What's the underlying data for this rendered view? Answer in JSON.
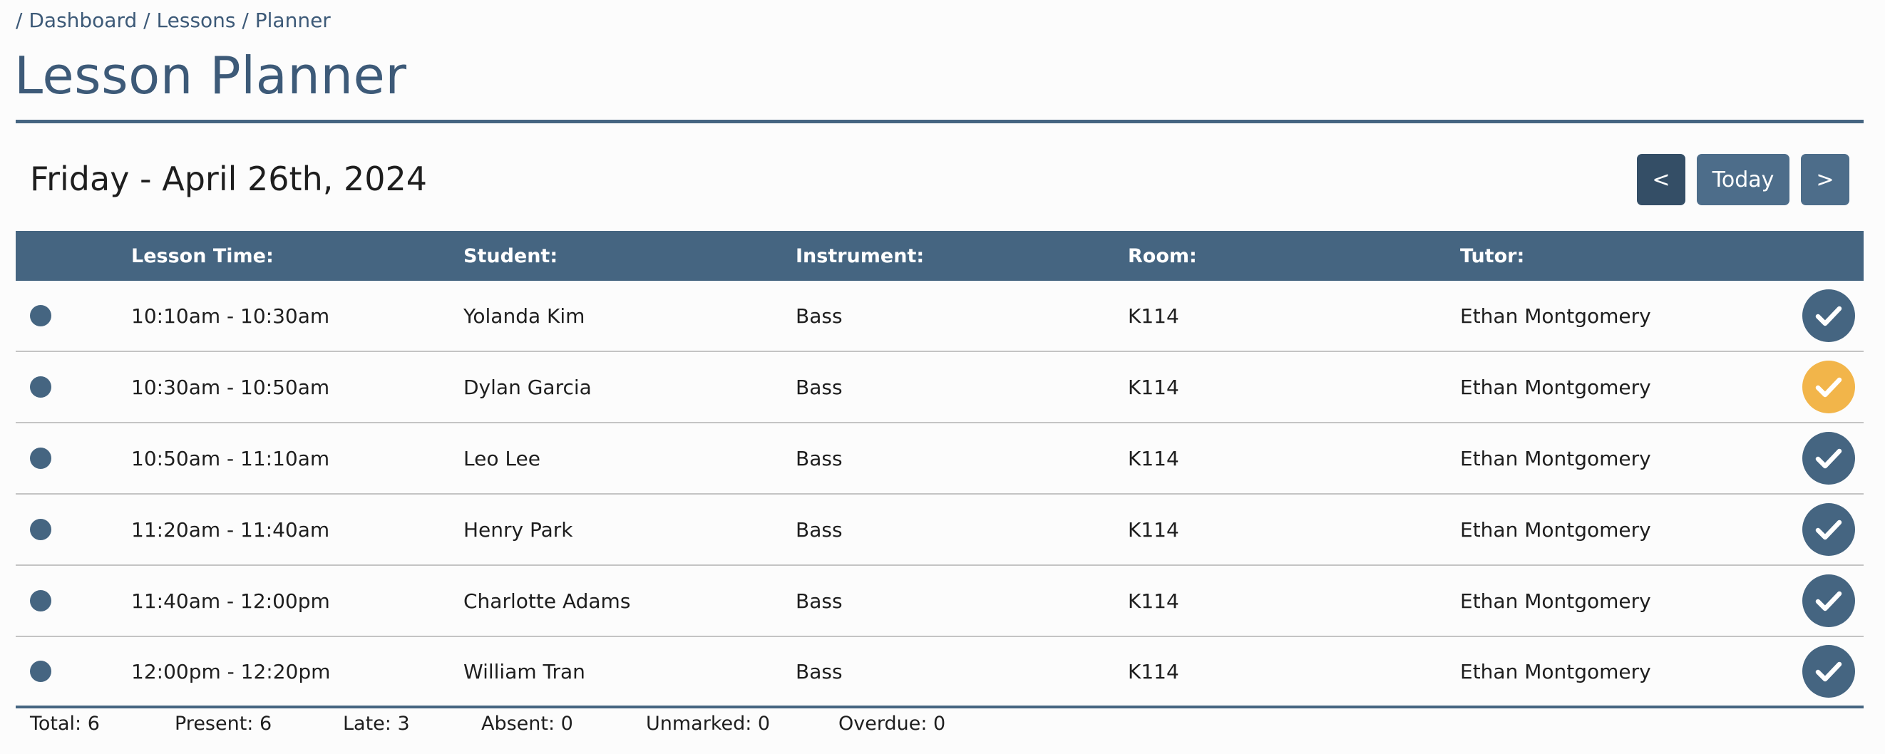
{
  "breadcrumb": {
    "sep": "/",
    "items": [
      "Dashboard",
      "Lessons",
      "Planner"
    ]
  },
  "page_title": "Lesson Planner",
  "date_heading": "Friday - April 26th, 2024",
  "nav": {
    "prev_label": "<",
    "today_label": "Today",
    "next_label": ">"
  },
  "table": {
    "headers": {
      "time": "Lesson Time:",
      "student": "Student:",
      "instrument": "Instrument:",
      "room": "Room:",
      "tutor": "Tutor:"
    },
    "rows": [
      {
        "time": "10:10am - 10:30am",
        "student": "Yolanda Kim",
        "instrument": "Bass",
        "room": "K114",
        "tutor": "Ethan Montgomery",
        "status": "present"
      },
      {
        "time": "10:30am - 10:50am",
        "student": "Dylan Garcia",
        "instrument": "Bass",
        "room": "K114",
        "tutor": "Ethan Montgomery",
        "status": "late"
      },
      {
        "time": "10:50am - 11:10am",
        "student": "Leo Lee",
        "instrument": "Bass",
        "room": "K114",
        "tutor": "Ethan Montgomery",
        "status": "present"
      },
      {
        "time": "11:20am - 11:40am",
        "student": "Henry Park",
        "instrument": "Bass",
        "room": "K114",
        "tutor": "Ethan Montgomery",
        "status": "present"
      },
      {
        "time": "11:40am - 12:00pm",
        "student": "Charlotte Adams",
        "instrument": "Bass",
        "room": "K114",
        "tutor": "Ethan Montgomery",
        "status": "present"
      },
      {
        "time": "12:00pm - 12:20pm",
        "student": "William Tran",
        "instrument": "Bass",
        "room": "K114",
        "tutor": "Ethan Montgomery",
        "status": "present"
      }
    ]
  },
  "summary": {
    "total": "Total: 6",
    "present": "Present: 6",
    "late": "Late: 3",
    "absent": "Absent: 0",
    "unmarked": "Unmarked: 0",
    "overdue": "Overdue: 0"
  },
  "colors": {
    "primary": "#456581",
    "primary_dark": "#344e66",
    "late": "#f2b54a",
    "text_link": "#3d5a78"
  },
  "icons": {
    "status": "check-icon",
    "row_marker": "dot-icon"
  }
}
